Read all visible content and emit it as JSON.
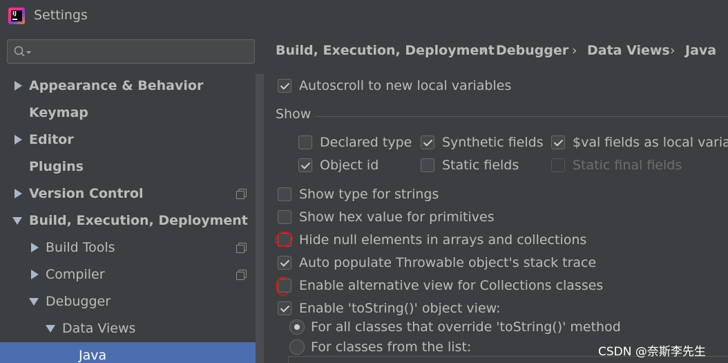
{
  "window": {
    "title": "Settings",
    "logo_text": "IJ"
  },
  "search": {
    "placeholder": ""
  },
  "sidebar": {
    "items": [
      {
        "label": "Appearance & Behavior"
      },
      {
        "label": "Keymap"
      },
      {
        "label": "Editor"
      },
      {
        "label": "Plugins"
      },
      {
        "label": "Version Control"
      },
      {
        "label": "Build, Execution, Deployment"
      },
      {
        "label": "Build Tools"
      },
      {
        "label": "Compiler"
      },
      {
        "label": "Debugger"
      },
      {
        "label": "Data Views"
      },
      {
        "label": "Java"
      }
    ]
  },
  "breadcrumb": {
    "items": [
      "Build, Execution, Deployment",
      "Debugger",
      "Data Views",
      "Java"
    ],
    "separator": "›"
  },
  "options": {
    "autoscroll": {
      "label": "Autoscroll to new local variables",
      "checked": true
    },
    "show_section": "Show",
    "declared_type": {
      "label": "Declared type",
      "checked": false
    },
    "synthetic_fields": {
      "label": "Synthetic fields",
      "checked": true
    },
    "val_fields": {
      "label": "$val fields as local variab",
      "checked": true
    },
    "object_id": {
      "label": "Object id",
      "checked": true
    },
    "static_fields": {
      "label": "Static fields",
      "checked": false
    },
    "static_final_fields": {
      "label": "Static final fields",
      "checked": false,
      "enabled": false
    },
    "type_for_strings": {
      "label": "Show type for strings",
      "checked": false
    },
    "hex_primitives": {
      "label": "Show hex value for primitives",
      "checked": false
    },
    "hide_null": {
      "label": "Hide null elements in arrays and collections",
      "checked": false
    },
    "auto_populate": {
      "label": "Auto populate Throwable object's stack trace",
      "checked": true
    },
    "alt_view": {
      "label": "Enable alternative view for Collections classes",
      "checked": false
    },
    "tostring_view": {
      "label": "Enable 'toString()' object view:",
      "checked": true
    },
    "radio_all": {
      "label": "For all classes that override 'toString()' method",
      "selected": true
    },
    "radio_list": {
      "label": "For classes from the list:",
      "selected": false
    }
  },
  "watermark": "CSDN @奈斯李先生",
  "colors": {
    "background": "#3c3f41",
    "selection": "#4b6eaf",
    "text": "#bbbbbb",
    "annotation": "#e01010"
  }
}
